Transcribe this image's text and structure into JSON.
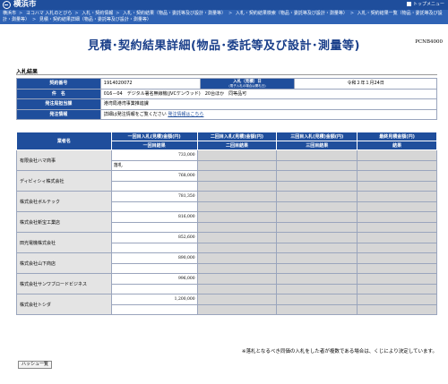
{
  "header": {
    "logo_text": "横浜市",
    "top_menu_label": "トップメニュー"
  },
  "breadcrumb": [
    "横浜市",
    "ヨコハマ 入札のとびら",
    "入札・契約情報",
    "入札・契約結果（物品・委託等及び設計・測量等）",
    "入札・契約結果検索（物品・委託等及び設計・測量等）",
    "入札・契約結果一覧（物品・委託等及び設計・測量等）",
    "見積・契約結果詳細（物品・委託等及び設計・測量等）"
  ],
  "page": {
    "title": "見積･契約結果詳細(物品･委託等及び設計･測量等)",
    "code": "PCNB4000",
    "section_label": "入札結果"
  },
  "info": {
    "contract_no_label": "契約番号",
    "contract_no": "1914020072",
    "bid_date_label": "入札（見積）日",
    "bid_date_sub": "(電子入札の場合は開札日)",
    "bid_date": "令和２年１月24日",
    "subject_label": "件　名",
    "subject": "016－04　デジタル署名無線機(JVCケンウッド)　20台ほか　同等品可",
    "department_label": "発注局担当課",
    "department": "港湾局港湾事業推進課",
    "info_label": "発注情報",
    "info_text": "詳細は発注情報をご覧ください",
    "info_link": "発注情報はこちら"
  },
  "table": {
    "headers": {
      "company": "業者名",
      "round1": "一回目入札(見積)金額(円)",
      "round2": "二回目入札(見積)金額(円)",
      "round3": "三回目入札(見積)金額(円)",
      "final": "最終見積金額(円)"
    },
    "subheaders": {
      "round1": "一回目結果",
      "round2": "二回目結果",
      "round3": "三回目結果",
      "final": "結果"
    },
    "rows": [
      {
        "company": "有限会社ハマ商事",
        "amount": "733,000",
        "note": "落札"
      },
      {
        "company": "ディビィシィ株式会社",
        "amount": "768,000",
        "note": ""
      },
      {
        "company": "株式会社ボルテック",
        "amount": "781,350",
        "note": ""
      },
      {
        "company": "株式会社新宝工業店",
        "amount": "816,000",
        "note": ""
      },
      {
        "company": "田光電機株式会社",
        "amount": "852,600",
        "note": ""
      },
      {
        "company": "株式会社山下商店",
        "amount": "890,000",
        "note": ""
      },
      {
        "company": "株式会社サンワブロードビジネス",
        "amount": "996,000",
        "note": ""
      },
      {
        "company": "株式会社トシダ",
        "amount": "1,200,000",
        "note": ""
      }
    ]
  },
  "footnote": "※落札となるべき同価の入札をした者が複数である場合は、くじにより決定しています。",
  "bottom_button": "ハッシュ一覧"
}
